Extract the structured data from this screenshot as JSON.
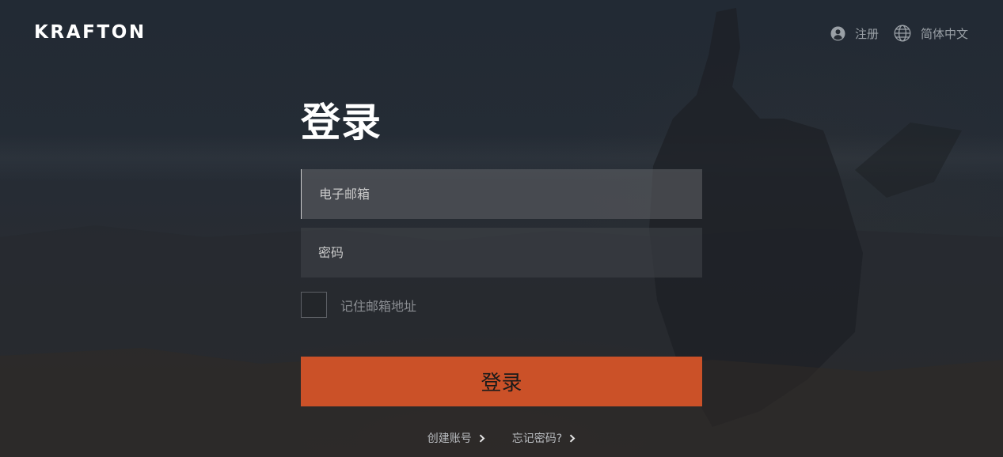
{
  "header": {
    "logo": "KRAFTON",
    "register_label": "注册",
    "register_icon": "user-circle-icon",
    "language_label": "简体中文",
    "language_icon": "globe-icon"
  },
  "login": {
    "title": "登录",
    "email_placeholder": "电子邮箱",
    "password_placeholder": "密码",
    "remember_label": "记住邮箱地址",
    "remember_checked": false,
    "submit_label": "登录"
  },
  "footer_links": {
    "create_account": "创建账号",
    "forgot_password": "忘记密码?"
  },
  "colors": {
    "accent": "#cb5128",
    "background": "#1f252d"
  }
}
